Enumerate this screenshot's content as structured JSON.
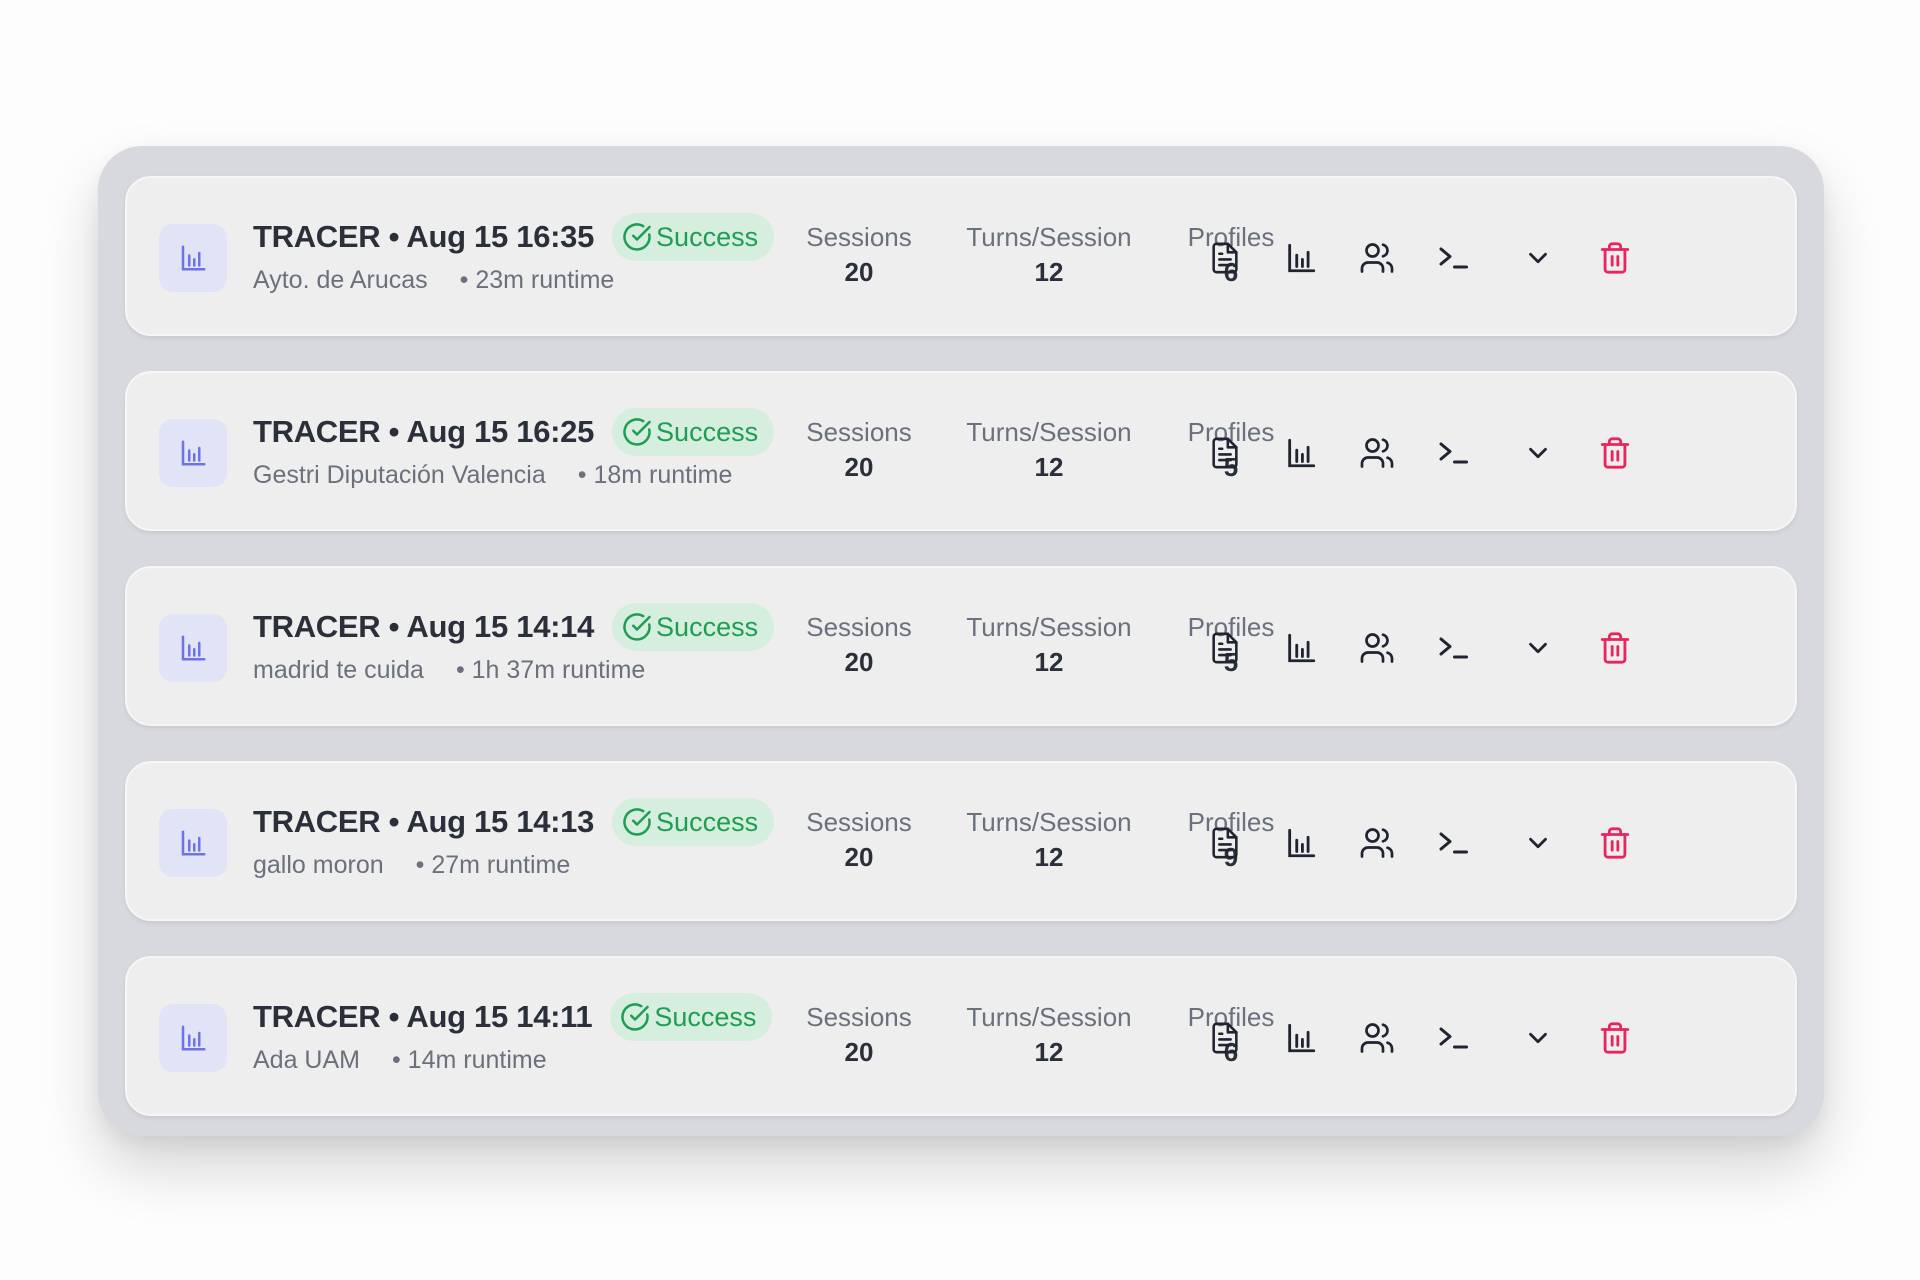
{
  "colors": {
    "panel_bg": "#d8d9de",
    "card_bg": "#eeeeef",
    "icon_tile_bg": "#e1e3f6",
    "icon_tile_fg": "#6d73e6",
    "success_bg": "#d6eedd",
    "success_fg": "#1e9e53",
    "delete_fg": "#e8265e",
    "text_primary": "#2a2f3a",
    "text_secondary": "#6b717c"
  },
  "labels": {
    "sessions": "Sessions",
    "turns": "Turns/Session",
    "profiles": "Profiles"
  },
  "icons": {
    "type": "bar-chart-icon",
    "status": "check-circle-icon",
    "actions": [
      "document-icon",
      "bar-chart-icon",
      "users-icon",
      "terminal-icon",
      "chevron-down-icon",
      "trash-icon"
    ]
  },
  "runs": [
    {
      "title": "TRACER • Aug 15 16:35",
      "status": "Success",
      "subtitle": "Ayto. de Arucas",
      "runtime": "• 23m runtime",
      "sessions": "20",
      "turns": "12",
      "profiles": "6"
    },
    {
      "title": "TRACER • Aug 15 16:25",
      "status": "Success",
      "subtitle": "Gestri Diputación Valencia",
      "runtime": "• 18m runtime",
      "sessions": "20",
      "turns": "12",
      "profiles": "5"
    },
    {
      "title": "TRACER • Aug 15 14:14",
      "status": "Success",
      "subtitle": "madrid te cuida",
      "runtime": "• 1h 37m runtime",
      "sessions": "20",
      "turns": "12",
      "profiles": "5"
    },
    {
      "title": "TRACER • Aug 15 14:13",
      "status": "Success",
      "subtitle": "gallo moron",
      "runtime": "• 27m runtime",
      "sessions": "20",
      "turns": "12",
      "profiles": "9"
    },
    {
      "title": "TRACER • Aug 15 14:11",
      "status": "Success",
      "subtitle": "Ada UAM",
      "runtime": "• 14m runtime",
      "sessions": "20",
      "turns": "12",
      "profiles": "6"
    }
  ]
}
